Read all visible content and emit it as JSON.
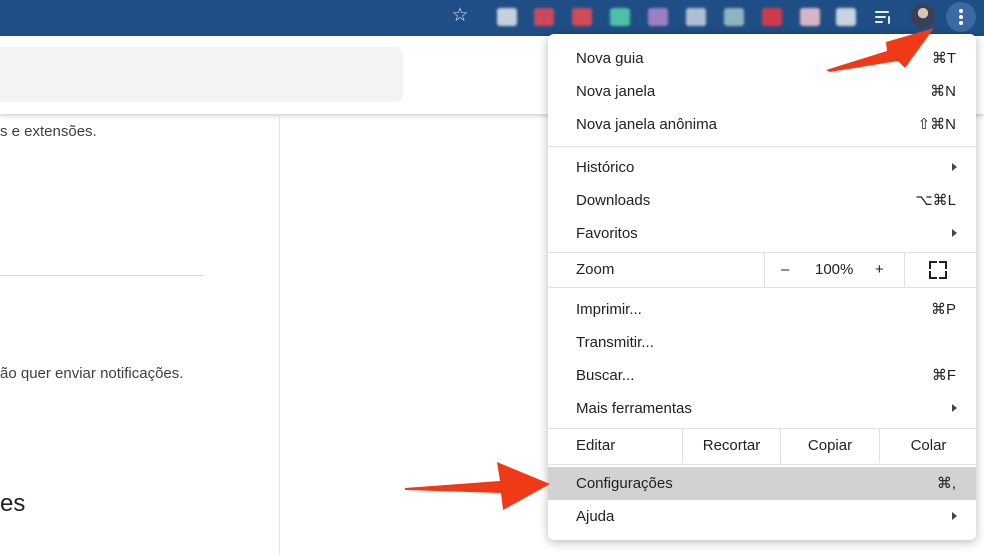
{
  "browser": {
    "accent_color": "#1f4e86",
    "star_icon": "star-icon",
    "extensions": [
      "#c7cfdc",
      "#c84a5c",
      "#cf4b57",
      "#4fbfa8",
      "#9a7fc2",
      "#aebed4",
      "#8fb3c0",
      "#cf3a4c",
      "#d7b5c6",
      "#c9d3e0"
    ]
  },
  "page": {
    "text_fragment_1": "s e extensões.",
    "text_fragment_2": "ão quer enviar notificações.",
    "text_fragment_3": "es"
  },
  "menu": {
    "items_top": [
      {
        "label": "Nova guia",
        "shortcut": "⌘T"
      },
      {
        "label": "Nova janela",
        "shortcut": "⌘N"
      },
      {
        "label": "Nova janela anônima",
        "shortcut": "⇧⌘N"
      }
    ],
    "items_mid": [
      {
        "label": "Histórico",
        "submenu": true
      },
      {
        "label": "Downloads",
        "shortcut": "⌥⌘L"
      },
      {
        "label": "Favoritos",
        "submenu": true
      }
    ],
    "zoom": {
      "label": "Zoom",
      "minus": "–",
      "value": "100%",
      "plus": "+"
    },
    "items_tools": [
      {
        "label": "Imprimir...",
        "shortcut": "⌘P"
      },
      {
        "label": "Transmitir..."
      },
      {
        "label": "Buscar...",
        "shortcut": "⌘F"
      },
      {
        "label": "Mais ferramentas",
        "submenu": true
      }
    ],
    "edit": {
      "label": "Editar",
      "cut": "Recortar",
      "copy": "Copiar",
      "paste": "Colar"
    },
    "settings": {
      "label": "Configurações",
      "shortcut": "⌘,"
    },
    "help": {
      "label": "Ajuda"
    }
  },
  "annotation": {
    "arrow_color": "#f03a17"
  }
}
